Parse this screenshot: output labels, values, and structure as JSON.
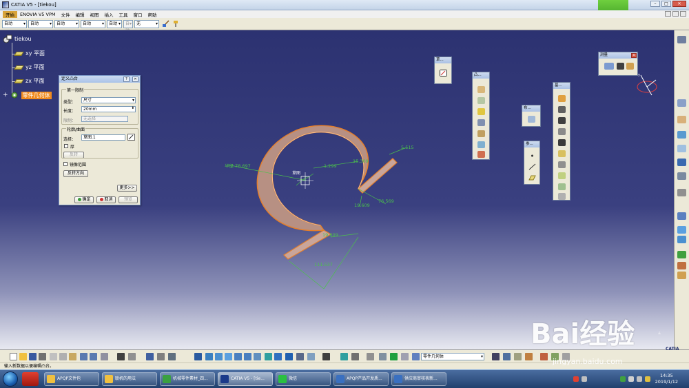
{
  "window": {
    "title": "CATIA V5 - [tiekou]"
  },
  "menu": {
    "items": [
      "开始",
      "ENOVIA V5 VPM",
      "文件",
      "编辑",
      "视图",
      "插入",
      "工具",
      "窗口",
      "帮助"
    ]
  },
  "dropdown_toolbar": {
    "items": [
      "自动",
      "自动",
      "自动",
      "自动",
      "自动",
      "自动",
      "无"
    ]
  },
  "spec_tree": {
    "root": "tiekou",
    "items": [
      "xy 平面",
      "yz 平面",
      "zx 平面"
    ],
    "body": "零件几何体"
  },
  "pad_dialog": {
    "title": "定义凸台",
    "help_btn": "?",
    "first_limit_label": "第一限制",
    "type_label": "类型：",
    "type_value": "尺寸",
    "length_label": "长度：",
    "length_value": "20mm",
    "limit_label": "限制：",
    "limit_value": "无选择",
    "reverse_btn": "反转",
    "profile_group": "轮廓/曲面",
    "selection_label": "选择：",
    "selection_value": "草图.1",
    "thick_label": "厚",
    "mirror_label": "镜像范围",
    "reverse_direction": "反转方向",
    "more_btn": "更多>>",
    "ok_btn": "确定",
    "cancel_btn": "取消",
    "preview_btn": "预览"
  },
  "floating_toolbars": {
    "sketch_head": "草...",
    "features_head": "凸...",
    "body_head": "布...",
    "reference_head": "参...",
    "feat2_head": "基...",
    "measure_head": "测量"
  },
  "dimensions": {
    "radius": "半径 78.697",
    "d1": "15.309",
    "d2": "5.515",
    "d3": "19.609",
    "d4": "76.569",
    "d5": "19.609",
    "d6": "111.537",
    "d7": "1.299",
    "center_label": "草图"
  },
  "bottom_toolbar": {
    "body_select": "零件几何体"
  },
  "status": {
    "text": "输入新数据以便编辑凸台。"
  },
  "taskbar": {
    "items": [
      "APQP文件包",
      "联机的用法",
      "机械零件素材_四...",
      "CATIA V5 - [tie...",
      "微信",
      "APQP产品开发质...",
      "供应商审核表新..."
    ],
    "time": "14:35",
    "date": "2019/1/12"
  },
  "overlay": {
    "logo_text": "中",
    "watermark": "Bai经验",
    "watermark_url": "jingyan.baidu.com",
    "brand": "CATIA"
  },
  "colors": {
    "viewport_top": "#2c3271",
    "body_highlight": "#f08a1e",
    "dimension": "#4bc24b",
    "part_fill": "#c9a59a"
  }
}
